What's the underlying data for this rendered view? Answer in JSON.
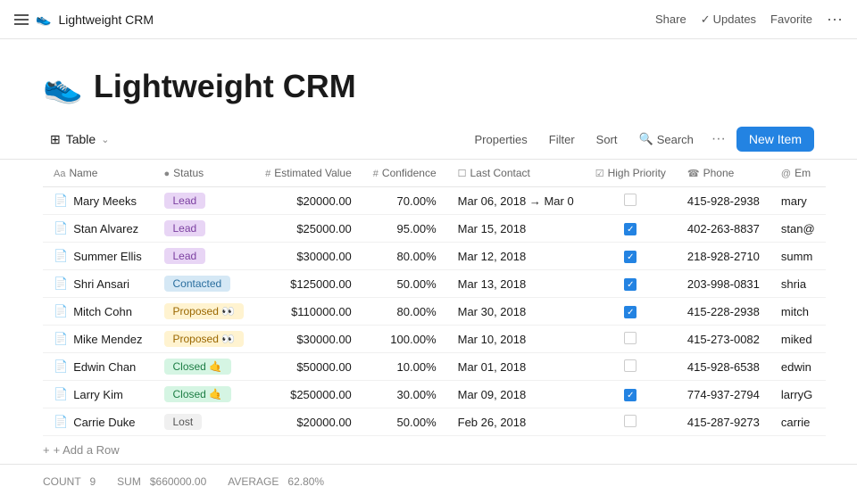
{
  "nav": {
    "hamburger_label": "menu",
    "brand": "Lightweight CRM",
    "brand_emoji": "👟",
    "share": "Share",
    "updates": "Updates",
    "favorite": "Favorite",
    "more": "···"
  },
  "page": {
    "emoji": "👟",
    "title": "Lightweight CRM"
  },
  "toolbar": {
    "view_icon": "⊞",
    "view_label": "Table",
    "chevron": "∨",
    "properties": "Properties",
    "filter": "Filter",
    "sort": "Sort",
    "search_icon": "🔍",
    "search": "Search",
    "more": "···",
    "new_item": "New Item"
  },
  "table": {
    "columns": [
      {
        "id": "name",
        "icon": "Aa",
        "label": "Name"
      },
      {
        "id": "status",
        "icon": "●",
        "label": "Status"
      },
      {
        "id": "estimated_value",
        "icon": "#",
        "label": "Estimated Value"
      },
      {
        "id": "confidence",
        "icon": "#",
        "label": "Confidence"
      },
      {
        "id": "last_contact",
        "icon": "☐",
        "label": "Last Contact"
      },
      {
        "id": "high_priority",
        "icon": "☑",
        "label": "High Priority"
      },
      {
        "id": "phone",
        "icon": "☎",
        "label": "Phone"
      },
      {
        "id": "email",
        "icon": "@",
        "label": "Em"
      }
    ],
    "rows": [
      {
        "id": 1,
        "name": "Mary Meeks",
        "status": "Lead",
        "status_type": "lead",
        "estimated_value": "$20000.00",
        "confidence": "70.00%",
        "last_contact": "Mar 06, 2018 → Mar 0",
        "high_priority": false,
        "phone": "415-928-2938",
        "email": "mary"
      },
      {
        "id": 2,
        "name": "Stan Alvarez",
        "status": "Lead",
        "status_type": "lead",
        "estimated_value": "$25000.00",
        "confidence": "95.00%",
        "last_contact": "Mar 15, 2018",
        "high_priority": true,
        "phone": "402-263-8837",
        "email": "stan@"
      },
      {
        "id": 3,
        "name": "Summer Ellis",
        "status": "Lead",
        "status_type": "lead",
        "estimated_value": "$30000.00",
        "confidence": "80.00%",
        "last_contact": "Mar 12, 2018",
        "high_priority": true,
        "phone": "218-928-2710",
        "email": "summ"
      },
      {
        "id": 4,
        "name": "Shri Ansari",
        "status": "Contacted",
        "status_type": "contacted",
        "estimated_value": "$125000.00",
        "confidence": "50.00%",
        "last_contact": "Mar 13, 2018",
        "high_priority": true,
        "phone": "203-998-0831",
        "email": "shria"
      },
      {
        "id": 5,
        "name": "Mitch Cohn",
        "status": "Proposed 👀",
        "status_type": "proposed",
        "estimated_value": "$110000.00",
        "confidence": "80.00%",
        "last_contact": "Mar 30, 2018",
        "high_priority": true,
        "phone": "415-228-2938",
        "email": "mitch"
      },
      {
        "id": 6,
        "name": "Mike Mendez",
        "status": "Proposed 👀",
        "status_type": "proposed",
        "estimated_value": "$30000.00",
        "confidence": "100.00%",
        "last_contact": "Mar 10, 2018",
        "high_priority": false,
        "phone": "415-273-0082",
        "email": "miked"
      },
      {
        "id": 7,
        "name": "Edwin Chan",
        "status": "Closed 🤙",
        "status_type": "closed",
        "estimated_value": "$50000.00",
        "confidence": "10.00%",
        "last_contact": "Mar 01, 2018",
        "high_priority": false,
        "phone": "415-928-6538",
        "email": "edwin"
      },
      {
        "id": 8,
        "name": "Larry Kim",
        "status": "Closed 🤙",
        "status_type": "closed",
        "estimated_value": "$250000.00",
        "confidence": "30.00%",
        "last_contact": "Mar 09, 2018",
        "high_priority": true,
        "phone": "774-937-2794",
        "email": "larryG"
      },
      {
        "id": 9,
        "name": "Carrie Duke",
        "status": "Lost",
        "status_type": "lost",
        "estimated_value": "$20000.00",
        "confidence": "50.00%",
        "last_contact": "Feb 26, 2018",
        "high_priority": false,
        "phone": "415-287-9273",
        "email": "carrie"
      }
    ],
    "add_row": "+ Add a Row",
    "footer": {
      "count_label": "COUNT",
      "count_value": "9",
      "sum_label": "SUM",
      "sum_value": "$660000.00",
      "avg_label": "AVERAGE",
      "avg_value": "62.80%"
    }
  }
}
